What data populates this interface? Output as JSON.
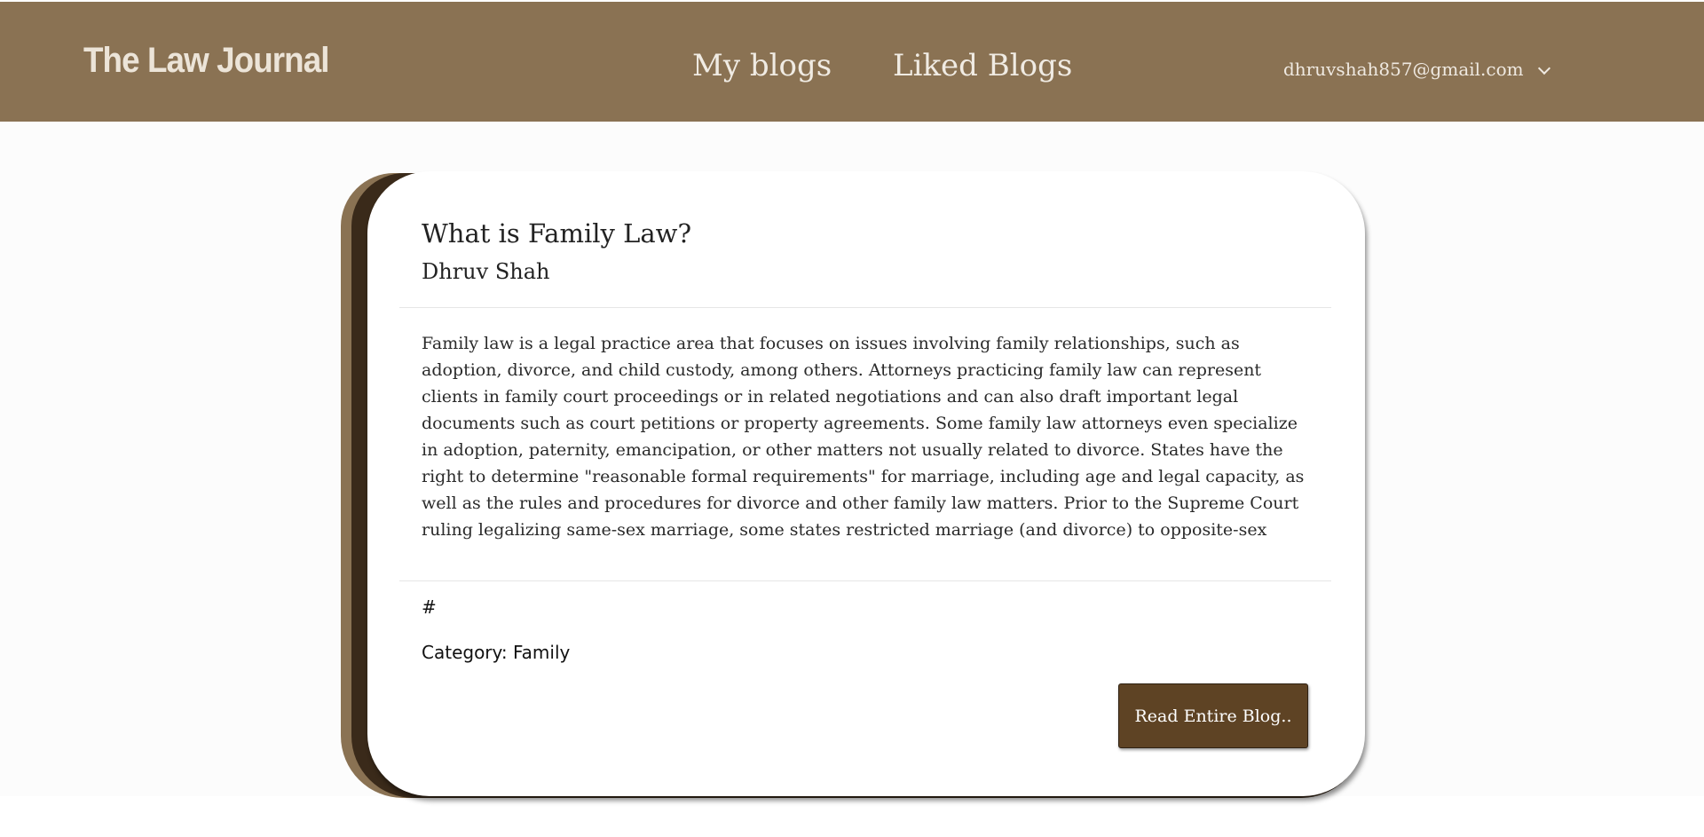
{
  "navbar": {
    "brand": "The Law Journal",
    "links": [
      "My blogs",
      "Liked Blogs"
    ],
    "user_email": "dhruvshah857@gmail.com",
    "dropdown_icon": "chevron-down-icon",
    "background_color": "#8a7253"
  },
  "blog": {
    "title": "What is Family Law?",
    "author": "Dhruv Shah",
    "body": "Family law is a legal practice area that focuses on issues involving family relationships, such as adoption, divorce, and child custody, among others. Attorneys practicing family law can represent clients in family court proceedings or in related negotiations and can also draft important legal documents such as court petitions or property agreements. Some family law attorneys even specialize in adoption, paternity, emancipation, or other matters not usually related to divorce. States have the right to determine \"reasonable formal requirements\" for marriage, including age and legal capacity, as well as the rules and procedures for divorce and other family law matters. Prior to the Supreme Court ruling legalizing same-sex marriage, some states restricted marriage (and divorce) to opposite-sex",
    "tag": "#",
    "category": "Category: Family",
    "read_button": "Read Entire Blog..",
    "button_color": "#5e4324"
  }
}
